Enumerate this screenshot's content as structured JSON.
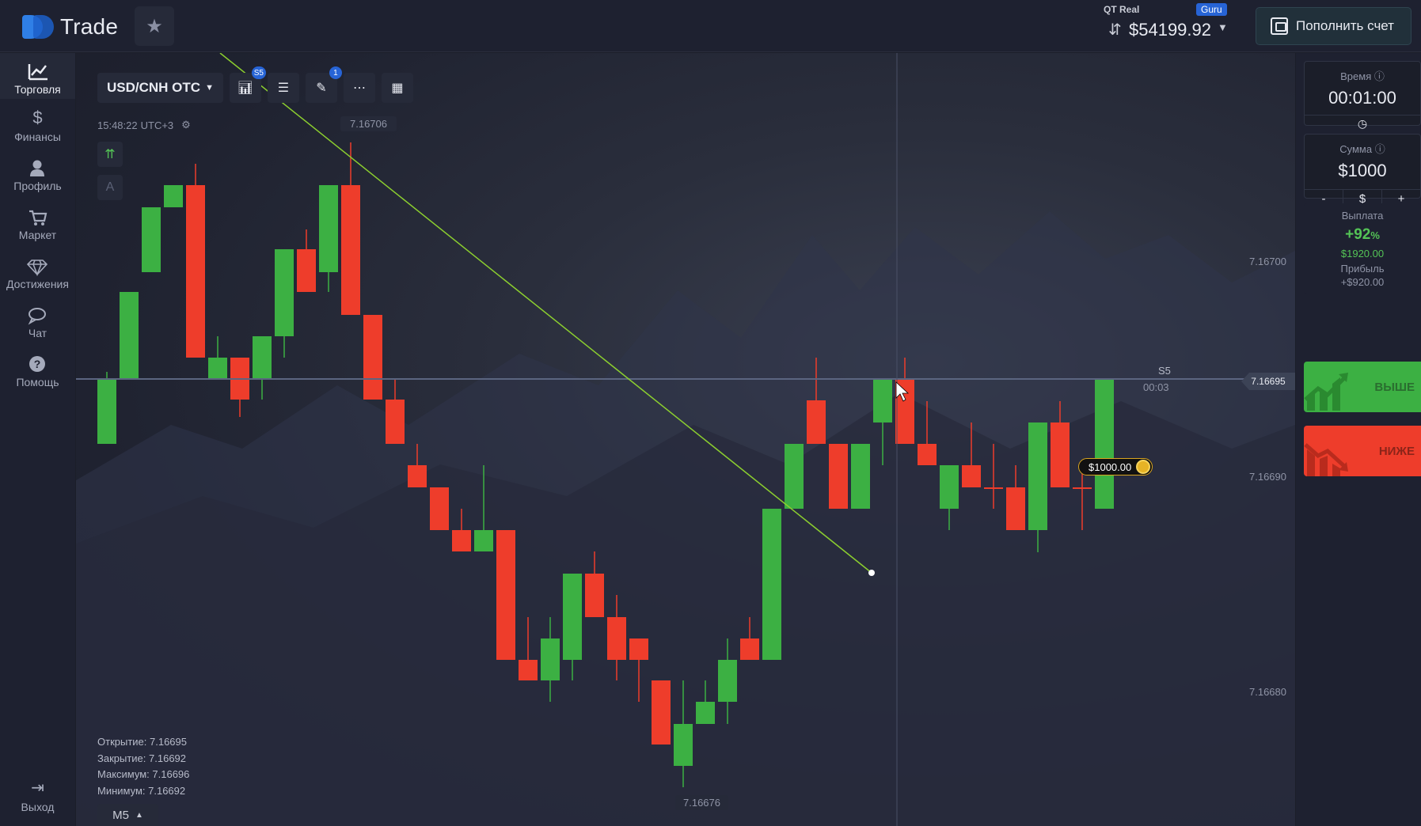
{
  "header": {
    "logo_text": "Trade",
    "account_name": "QT Real",
    "account_badge": "Guru",
    "balance": "$54199.92",
    "deposit_label": "Пополнить счет"
  },
  "sidebar": {
    "items": [
      {
        "label": "Торговля",
        "icon": "chart-line-icon"
      },
      {
        "label": "Финансы",
        "icon": "dollar-icon"
      },
      {
        "label": "Профиль",
        "icon": "user-icon"
      },
      {
        "label": "Маркет",
        "icon": "cart-icon"
      },
      {
        "label": "Достижения",
        "icon": "diamond-icon"
      },
      {
        "label": "Чат",
        "icon": "chat-icon"
      },
      {
        "label": "Помощь",
        "icon": "help-icon"
      }
    ],
    "logout_label": "Выход"
  },
  "toolbar": {
    "pair": "USD/CNH OTC",
    "chart_type_badge": "S5",
    "drawings_badge": "1"
  },
  "chart": {
    "time": "15:48:22",
    "timezone": "UTC+3",
    "top_price": "7.16706",
    "bottom_price": "7.16676",
    "current_price": "7.16695",
    "axis_prices": [
      "7.16700",
      "7.16690",
      "7.16680"
    ],
    "s5_label": "S5",
    "countdown": "00:03",
    "trade_amount": "$1000.00",
    "timeframe": "M5",
    "ohlc": {
      "open": "Открытие: 7.16695",
      "close": "Закрытие: 7.16692",
      "high": "Максимум: 7.16696",
      "low": "Минимум: 7.16692"
    },
    "up_color": "#3cb043",
    "down_color": "#ee3d2b"
  },
  "right_panel": {
    "time_title": "Время",
    "time_value": "00:01:00",
    "amount_title": "Сумма",
    "amount_value": "$1000",
    "amount_minus": "-",
    "amount_currency": "$",
    "amount_plus": "+",
    "payout_title": "Выплата",
    "payout_pct": "+92",
    "payout_pct_unit": "%",
    "payout_amount": "$1920.00",
    "profit_label": "Прибыль",
    "profit_amount": "+$920.00",
    "higher_label": "ВЫШЕ",
    "lower_label": "НИЖЕ"
  }
}
